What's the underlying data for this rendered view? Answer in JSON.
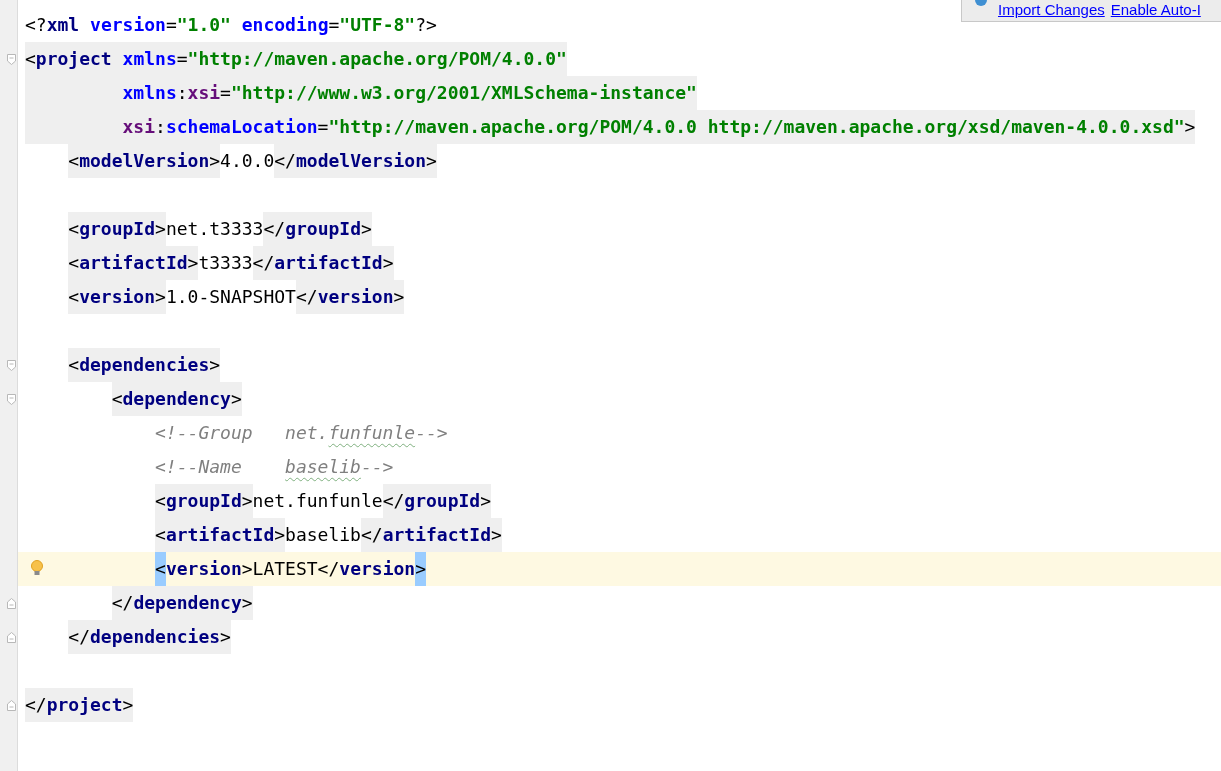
{
  "notification": {
    "links": [
      "Import Changes",
      "Enable Auto-I"
    ]
  },
  "editor": {
    "lines": [
      {
        "kind": "prolog",
        "current": false,
        "tokens": [
          {
            "kind": "punct",
            "text": "<?"
          },
          {
            "kind": "name",
            "text": "xml"
          },
          {
            "kind": "attr",
            "text": " version"
          },
          {
            "kind": "punct",
            "text": "="
          },
          {
            "kind": "value",
            "text": "\"1.0\""
          },
          {
            "kind": "attr",
            "text": " encoding"
          },
          {
            "kind": "punct",
            "text": "="
          },
          {
            "kind": "value",
            "text": "\"UTF-8\""
          },
          {
            "kind": "punct",
            "text": "?>"
          }
        ]
      },
      {
        "kind": "element",
        "current": false,
        "fold_start": true,
        "tokens": [
          {
            "kind": "punct",
            "text": "<"
          },
          {
            "kind": "name",
            "text": "project"
          },
          {
            "kind": "attr",
            "text": " xmlns"
          },
          {
            "kind": "punct",
            "text": "="
          },
          {
            "kind": "value",
            "text": "\"http://maven.apache.org/POM/4.0.0\""
          }
        ],
        "continuations": [
          {
            "current": false,
            "tokens": [
              {
                "kind": "attr",
                "text": "xmlns"
              },
              {
                "kind": "punct",
                "text": ":"
              },
              {
                "kind": "ns",
                "text": "xsi"
              },
              {
                "kind": "punct",
                "text": "="
              },
              {
                "kind": "value",
                "text": "\"http://www.w3.org/2001/XMLSchema-instance\""
              }
            ]
          },
          {
            "current": false,
            "tokens": [
              {
                "kind": "ns",
                "text": "xsi"
              },
              {
                "kind": "punct",
                "text": ":"
              },
              {
                "kind": "attr",
                "text": "schemaLocation"
              },
              {
                "kind": "punct",
                "text": "="
              },
              {
                "kind": "value",
                "text": "\"http://maven.apache.org/POM/4.0.0 http://maven.apache.org/xsd/maven-4.0.0.xsd\""
              },
              {
                "kind": "punct",
                "text": ">"
              }
            ]
          }
        ],
        "children": [
          {
            "kind": "element",
            "current": false,
            "tokens": [
              {
                "kind": "punct",
                "text": "<"
              },
              {
                "kind": "name",
                "text": "modelVersion"
              },
              {
                "kind": "punct",
                "text": ">"
              },
              {
                "kind": "text",
                "text": "4.0.0"
              },
              {
                "kind": "punct",
                "text": "</"
              },
              {
                "kind": "name",
                "text": "modelVersion"
              },
              {
                "kind": "punct",
                "text": ">"
              }
            ]
          },
          {
            "kind": "blank",
            "current": false
          },
          {
            "kind": "element",
            "current": false,
            "tokens": [
              {
                "kind": "punct",
                "text": "<"
              },
              {
                "kind": "name",
                "text": "groupId"
              },
              {
                "kind": "punct",
                "text": ">"
              },
              {
                "kind": "text",
                "text": "net.t3333"
              },
              {
                "kind": "punct",
                "text": "</"
              },
              {
                "kind": "name",
                "text": "groupId"
              },
              {
                "kind": "punct",
                "text": ">"
              }
            ]
          },
          {
            "kind": "element",
            "current": false,
            "tokens": [
              {
                "kind": "punct",
                "text": "<"
              },
              {
                "kind": "name",
                "text": "artifactId"
              },
              {
                "kind": "punct",
                "text": ">"
              },
              {
                "kind": "text",
                "text": "t3333"
              },
              {
                "kind": "punct",
                "text": "</"
              },
              {
                "kind": "name",
                "text": "artifactId"
              },
              {
                "kind": "punct",
                "text": ">"
              }
            ]
          },
          {
            "kind": "element",
            "current": false,
            "tokens": [
              {
                "kind": "punct",
                "text": "<"
              },
              {
                "kind": "name",
                "text": "version"
              },
              {
                "kind": "punct",
                "text": ">"
              },
              {
                "kind": "text",
                "text": "1.0-SNAPSHOT"
              },
              {
                "kind": "punct",
                "text": "</"
              },
              {
                "kind": "name",
                "text": "version"
              },
              {
                "kind": "punct",
                "text": ">"
              }
            ]
          },
          {
            "kind": "blank",
            "current": false
          },
          {
            "kind": "element",
            "current": false,
            "fold_start": true,
            "tokens": [
              {
                "kind": "punct",
                "text": "<"
              },
              {
                "kind": "name",
                "text": "dependencies"
              },
              {
                "kind": "punct",
                "text": ">"
              }
            ],
            "children": [
              {
                "kind": "element",
                "current": false,
                "fold_start": true,
                "tokens": [
                  {
                    "kind": "punct",
                    "text": "<"
                  },
                  {
                    "kind": "name",
                    "text": "dependency"
                  },
                  {
                    "kind": "punct",
                    "text": ">"
                  }
                ],
                "children": [
                  {
                    "kind": "comment",
                    "current": false,
                    "tokens": [
                      {
                        "kind": "comment",
                        "text": "<!--Group   net."
                      },
                      {
                        "kind": "typo",
                        "text": "funfunle"
                      },
                      {
                        "kind": "comment",
                        "text": "-->"
                      }
                    ]
                  },
                  {
                    "kind": "comment",
                    "current": false,
                    "tokens": [
                      {
                        "kind": "comment",
                        "text": "<!--Name    "
                      },
                      {
                        "kind": "typo",
                        "text": "baselib"
                      },
                      {
                        "kind": "comment",
                        "text": "-->"
                      }
                    ]
                  },
                  {
                    "kind": "element",
                    "current": false,
                    "tokens": [
                      {
                        "kind": "punct",
                        "text": "<"
                      },
                      {
                        "kind": "name",
                        "text": "groupId"
                      },
                      {
                        "kind": "punct",
                        "text": ">"
                      },
                      {
                        "kind": "text",
                        "text": "net.funfunle"
                      },
                      {
                        "kind": "punct",
                        "text": "</"
                      },
                      {
                        "kind": "name",
                        "text": "groupId"
                      },
                      {
                        "kind": "punct",
                        "text": ">"
                      }
                    ]
                  },
                  {
                    "kind": "element",
                    "current": false,
                    "tokens": [
                      {
                        "kind": "punct",
                        "text": "<"
                      },
                      {
                        "kind": "name",
                        "text": "artifactId"
                      },
                      {
                        "kind": "punct",
                        "text": ">"
                      },
                      {
                        "kind": "text",
                        "text": "baselib"
                      },
                      {
                        "kind": "punct",
                        "text": "</"
                      },
                      {
                        "kind": "name",
                        "text": "artifactId"
                      },
                      {
                        "kind": "punct",
                        "text": ">"
                      }
                    ]
                  },
                  {
                    "kind": "element",
                    "current": true,
                    "bulb": true,
                    "tokens": [
                      {
                        "kind": "punct",
                        "text": "<"
                      },
                      {
                        "kind": "name",
                        "text": "version"
                      },
                      {
                        "kind": "punct",
                        "text": ">"
                      },
                      {
                        "kind": "text",
                        "text": "LATEST"
                      },
                      {
                        "kind": "punct",
                        "text": "</"
                      },
                      {
                        "kind": "name",
                        "text": "version"
                      },
                      {
                        "kind": "punct",
                        "text": ">"
                      }
                    ]
                  }
                ],
                "closing": {
                  "current": false,
                  "fold_end": true,
                  "tokens": [
                    {
                      "kind": "punct",
                      "text": "</"
                    },
                    {
                      "kind": "name",
                      "text": "dependency"
                    },
                    {
                      "kind": "punct",
                      "text": ">"
                    }
                  ]
                }
              }
            ],
            "closing": {
              "current": false,
              "fold_end": true,
              "tokens": [
                {
                  "kind": "punct",
                  "text": "</"
                },
                {
                  "kind": "name",
                  "text": "dependencies"
                },
                {
                  "kind": "punct",
                  "text": ">"
                }
              ]
            }
          },
          {
            "kind": "blank",
            "current": false
          }
        ],
        "closing": {
          "current": false,
          "fold_end": true,
          "tokens": [
            {
              "kind": "punct",
              "text": "</"
            },
            {
              "kind": "name",
              "text": "project"
            },
            {
              "kind": "punct",
              "text": ">"
            }
          ]
        }
      }
    ]
  }
}
